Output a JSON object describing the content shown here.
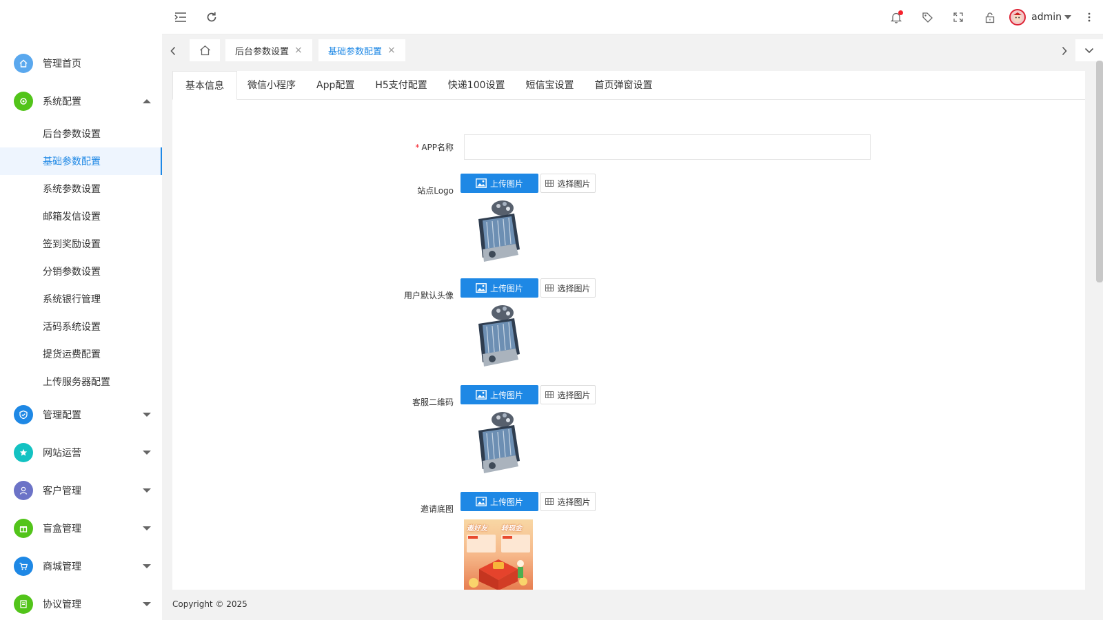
{
  "sidebar": {
    "brand": "",
    "items": [
      {
        "label": "管理首页",
        "icon": "home-icon",
        "color": "#5aa8ee"
      },
      {
        "label": "系统配置",
        "icon": "gear-icon",
        "color": "#52c41a",
        "expanded": true
      },
      {
        "label": "管理配置",
        "icon": "shield-icon",
        "color": "#1e88e5"
      },
      {
        "label": "网站运营",
        "icon": "star-icon",
        "color": "#13c2c2"
      },
      {
        "label": "客户管理",
        "icon": "user-icon",
        "color": "#6c73c7"
      },
      {
        "label": "盲盒管理",
        "icon": "gift-icon",
        "color": "#52c41a"
      },
      {
        "label": "商城管理",
        "icon": "cart-icon",
        "color": "#1e88e5"
      },
      {
        "label": "协议管理",
        "icon": "document-icon",
        "color": "#52c41a"
      }
    ],
    "sub_items": [
      "后台参数设置",
      "基础参数配置",
      "系统参数设置",
      "邮箱发信设置",
      "签到奖励设置",
      "分销参数设置",
      "系统银行管理",
      "活码系统设置",
      "提货运费配置",
      "上传服务器配置"
    ],
    "active_sub": 1
  },
  "header": {
    "username": "admin"
  },
  "tabs": [
    {
      "label": "后台参数设置",
      "active": false
    },
    {
      "label": "基础参数配置",
      "active": true
    }
  ],
  "content_tabs": [
    "基本信息",
    "微信小程序",
    "App配置",
    "H5支付配置",
    "快递100设置",
    "短信宝设置",
    "首页弹窗设置"
  ],
  "form": {
    "app_name": {
      "label": "APP名称",
      "value": "",
      "placeholder": ""
    },
    "logo": {
      "label": "站点Logo"
    },
    "avatar": {
      "label": "用户默认头像"
    },
    "qrcode": {
      "label": "客服二维码"
    },
    "invite": {
      "label": "邀请底图",
      "poster_text1": "邀好友",
      "poster_text2": "转现金"
    },
    "upload_label": "上传图片",
    "select_label": "选择图片"
  },
  "footer": "Copyright © 2025"
}
